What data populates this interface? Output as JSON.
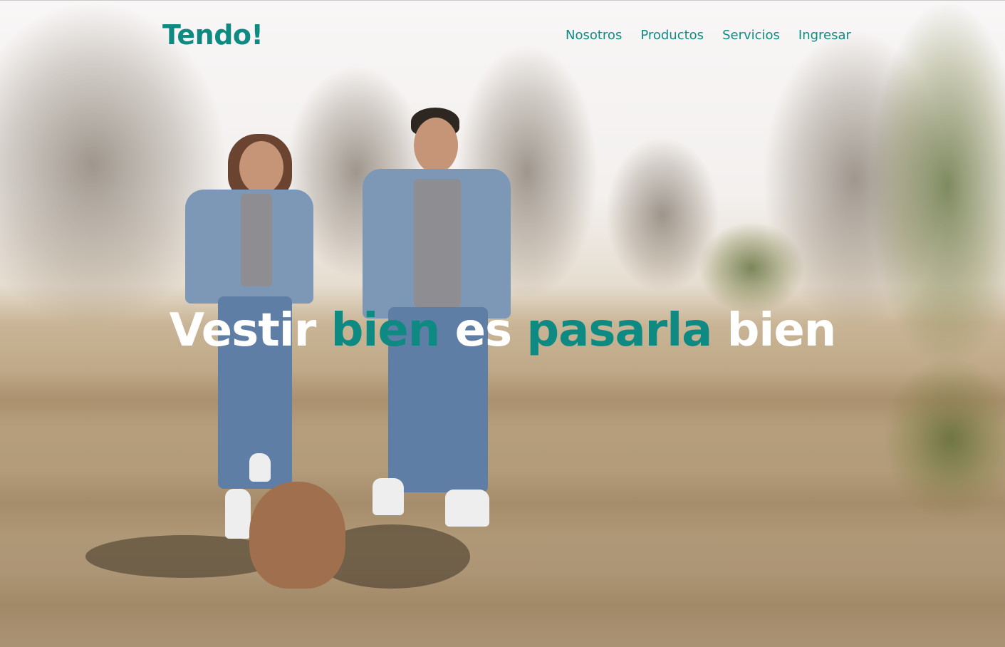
{
  "brand": {
    "logo": "Tendo!",
    "accent_color": "#0f8a82"
  },
  "nav": {
    "items": [
      {
        "label": "Nosotros"
      },
      {
        "label": "Productos"
      },
      {
        "label": "Servicios"
      },
      {
        "label": "Ingresar"
      }
    ]
  },
  "hero": {
    "headline_words": [
      {
        "text": "Vestir",
        "color": "#ffffff"
      },
      {
        "text": "bien",
        "color": "#0f8a82"
      },
      {
        "text": "es",
        "color": "#ffffff"
      },
      {
        "text": "pasarla",
        "color": "#0f8a82"
      },
      {
        "text": "bien",
        "color": "#ffffff"
      }
    ]
  }
}
